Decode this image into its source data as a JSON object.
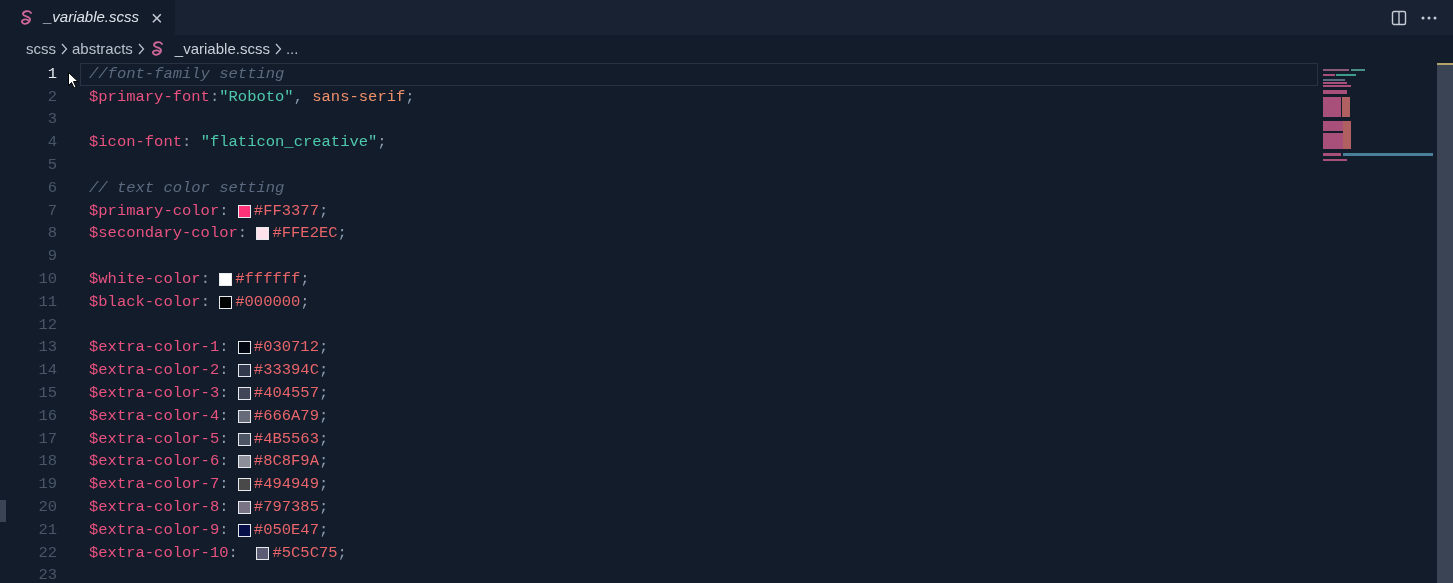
{
  "tabs": [
    {
      "label": "_variable.scss",
      "selected": true,
      "close": "×"
    }
  ],
  "breadcrumb": [
    {
      "text": "scss",
      "file": false
    },
    {
      "text": "abstracts",
      "file": false
    },
    {
      "text": "_variable.scss",
      "file": true
    },
    {
      "text": "...",
      "file": false
    }
  ],
  "editor": {
    "lines": [
      {
        "number": "1",
        "current": true,
        "tokens": [
          {
            "kind": "comment",
            "text": "//font-family setting"
          }
        ]
      },
      {
        "number": "2",
        "current": false,
        "tokens": [
          {
            "kind": "var",
            "text": "$primary-font"
          },
          {
            "kind": "punct",
            "text": ":"
          },
          {
            "kind": "string",
            "text": "\"Roboto\""
          },
          {
            "kind": "punct",
            "text": ", "
          },
          {
            "kind": "value",
            "text": "sans-serif"
          },
          {
            "kind": "punct",
            "text": ";"
          }
        ]
      },
      {
        "number": "3",
        "current": false
      },
      {
        "number": "4",
        "current": false,
        "tokens": [
          {
            "kind": "var",
            "text": "$icon-font"
          },
          {
            "kind": "punct",
            "text": ": "
          },
          {
            "kind": "string",
            "text": "\"flaticon_creative\""
          },
          {
            "kind": "punct",
            "text": ";"
          }
        ]
      },
      {
        "number": "5",
        "current": false
      },
      {
        "number": "6",
        "current": false,
        "tokens": [
          {
            "kind": "comment",
            "text": "// text color setting"
          }
        ]
      },
      {
        "number": "7",
        "current": false,
        "tokens": [
          {
            "kind": "var",
            "text": "$primary-color"
          },
          {
            "kind": "punct",
            "text": ": "
          },
          {
            "kind": "swatch",
            "color": "#ff3377"
          },
          {
            "kind": "hex",
            "text": "#FF3377"
          },
          {
            "kind": "punct",
            "text": ";"
          }
        ]
      },
      {
        "number": "8",
        "current": false,
        "tokens": [
          {
            "kind": "var",
            "text": "$secondary-color"
          },
          {
            "kind": "punct",
            "text": ": "
          },
          {
            "kind": "swatch",
            "color": "#ffe2ec"
          },
          {
            "kind": "hex",
            "text": "#FFE2EC"
          },
          {
            "kind": "punct",
            "text": ";"
          }
        ]
      },
      {
        "number": "9",
        "current": false
      },
      {
        "number": "10",
        "current": false,
        "tokens": [
          {
            "kind": "var",
            "text": "$white-color"
          },
          {
            "kind": "punct",
            "text": ": "
          },
          {
            "kind": "swatch",
            "color": "#ffffff"
          },
          {
            "kind": "hex",
            "text": "#ffffff"
          },
          {
            "kind": "punct",
            "text": ";"
          }
        ]
      },
      {
        "number": "11",
        "current": false,
        "tokens": [
          {
            "kind": "var",
            "text": "$black-color"
          },
          {
            "kind": "punct",
            "text": ": "
          },
          {
            "kind": "swatch",
            "color": "#000000"
          },
          {
            "kind": "hex",
            "text": "#000000"
          },
          {
            "kind": "punct",
            "text": ";"
          }
        ]
      },
      {
        "number": "12",
        "current": false
      },
      {
        "number": "13",
        "current": false,
        "tokens": [
          {
            "kind": "var",
            "text": "$extra-color-1"
          },
          {
            "kind": "punct",
            "text": ": "
          },
          {
            "kind": "swatch",
            "color": "#030712"
          },
          {
            "kind": "hex",
            "text": "#030712"
          },
          {
            "kind": "punct",
            "text": ";"
          }
        ]
      },
      {
        "number": "14",
        "current": false,
        "tokens": [
          {
            "kind": "var",
            "text": "$extra-color-2"
          },
          {
            "kind": "punct",
            "text": ": "
          },
          {
            "kind": "swatch",
            "color": "#33394c"
          },
          {
            "kind": "hex",
            "text": "#33394C"
          },
          {
            "kind": "punct",
            "text": ";"
          }
        ]
      },
      {
        "number": "15",
        "current": false,
        "tokens": [
          {
            "kind": "var",
            "text": "$extra-color-3"
          },
          {
            "kind": "punct",
            "text": ": "
          },
          {
            "kind": "swatch",
            "color": "#404557"
          },
          {
            "kind": "hex",
            "text": "#404557"
          },
          {
            "kind": "punct",
            "text": ";"
          }
        ]
      },
      {
        "number": "16",
        "current": false,
        "tokens": [
          {
            "kind": "var",
            "text": "$extra-color-4"
          },
          {
            "kind": "punct",
            "text": ": "
          },
          {
            "kind": "swatch",
            "color": "#666a79"
          },
          {
            "kind": "hex",
            "text": "#666A79"
          },
          {
            "kind": "punct",
            "text": ";"
          }
        ]
      },
      {
        "number": "17",
        "current": false,
        "tokens": [
          {
            "kind": "var",
            "text": "$extra-color-5"
          },
          {
            "kind": "punct",
            "text": ": "
          },
          {
            "kind": "swatch",
            "color": "#4b5563"
          },
          {
            "kind": "hex",
            "text": "#4B5563"
          },
          {
            "kind": "punct",
            "text": ";"
          }
        ]
      },
      {
        "number": "18",
        "current": false,
        "tokens": [
          {
            "kind": "var",
            "text": "$extra-color-6"
          },
          {
            "kind": "punct",
            "text": ": "
          },
          {
            "kind": "swatch",
            "color": "#8c8f9a"
          },
          {
            "kind": "hex",
            "text": "#8C8F9A"
          },
          {
            "kind": "punct",
            "text": ";"
          }
        ]
      },
      {
        "number": "19",
        "current": false,
        "tokens": [
          {
            "kind": "var",
            "text": "$extra-color-7"
          },
          {
            "kind": "punct",
            "text": ": "
          },
          {
            "kind": "swatch",
            "color": "#494949"
          },
          {
            "kind": "hex",
            "text": "#494949"
          },
          {
            "kind": "punct",
            "text": ";"
          }
        ]
      },
      {
        "number": "20",
        "current": false,
        "tokens": [
          {
            "kind": "var",
            "text": "$extra-color-8"
          },
          {
            "kind": "punct",
            "text": ": "
          },
          {
            "kind": "swatch",
            "color": "#797385"
          },
          {
            "kind": "hex",
            "text": "#797385"
          },
          {
            "kind": "punct",
            "text": ";"
          }
        ]
      },
      {
        "number": "21",
        "current": false,
        "tokens": [
          {
            "kind": "var",
            "text": "$extra-color-9"
          },
          {
            "kind": "punct",
            "text": ": "
          },
          {
            "kind": "swatch",
            "color": "#050e47"
          },
          {
            "kind": "hex",
            "text": "#050E47"
          },
          {
            "kind": "punct",
            "text": ";"
          }
        ]
      },
      {
        "number": "22",
        "current": false,
        "tokens": [
          {
            "kind": "var",
            "text": "$extra-color-10"
          },
          {
            "kind": "punct",
            "text": ":  "
          },
          {
            "kind": "swatch",
            "color": "#5c5c75"
          },
          {
            "kind": "hex",
            "text": "#5C5C75"
          },
          {
            "kind": "punct",
            "text": ";"
          }
        ]
      },
      {
        "number": "23",
        "current": false
      }
    ]
  }
}
